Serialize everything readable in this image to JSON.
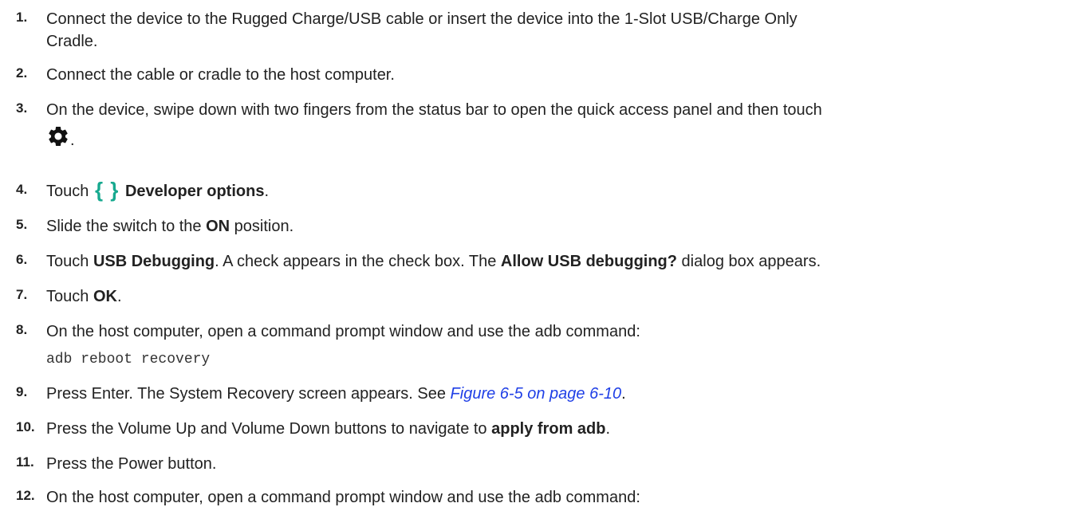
{
  "steps": [
    {
      "num": "1.",
      "line1": "Connect the device to the Rugged Charge/USB cable or insert the device into the 1-Slot USB/Charge Only",
      "line2": "Cradle."
    },
    {
      "num": "2.",
      "text": "Connect the cable or cradle to the host computer."
    },
    {
      "num": "3.",
      "line1": "On the device, swipe down with two fingers from the status bar to open the quick access panel and then touch",
      "icon": "gear-icon",
      "after_icon": "."
    },
    {
      "num": "4.",
      "pre": "Touch",
      "icon": "developer-options-braces-icon",
      "icon_glyph": "{ }",
      "bold": "Developer options",
      "post": "."
    },
    {
      "num": "5.",
      "pre": "Slide the switch to the ",
      "bold": "ON",
      "post": " position."
    },
    {
      "num": "6.",
      "pre": "Touch ",
      "bold": "USB Debugging",
      "mid": ". A check appears in the check box. The ",
      "bold2": "Allow USB debugging?",
      "post": " dialog box appears."
    },
    {
      "num": "7.",
      "pre": "Touch ",
      "bold": "OK",
      "post": "."
    },
    {
      "num": "8.",
      "text": "On the host computer, open a command prompt window and use the adb command:",
      "code": "adb reboot recovery"
    },
    {
      "num": "9.",
      "pre": "Press Enter. The System Recovery screen appears. See ",
      "link": "Figure 6-5 on page 6-10",
      "post": "."
    },
    {
      "num": "10.",
      "pre": "Press the Volume Up and Volume Down buttons to navigate to ",
      "bold": "apply from adb",
      "post": "."
    },
    {
      "num": "11.",
      "text": "Press the Power button."
    },
    {
      "num": "12.",
      "text": "On the host computer, open a command prompt window and use the adb command:"
    }
  ]
}
